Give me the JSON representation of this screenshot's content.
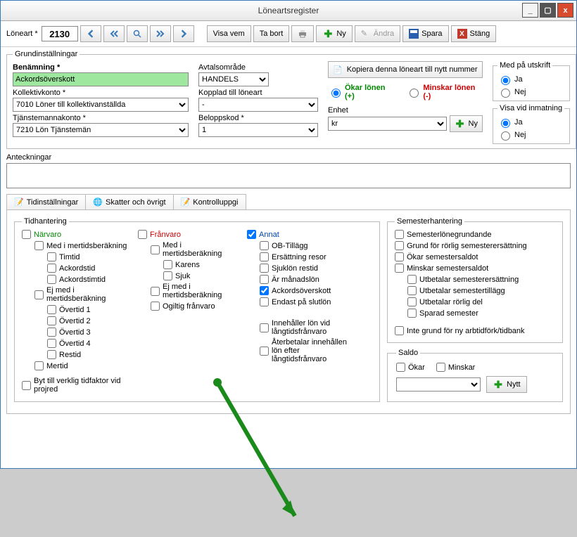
{
  "window": {
    "title": "Löneartsregister"
  },
  "toolbar": {
    "loneart_label": "Löneart *",
    "loneart_value": "2130",
    "visa_vem": "Visa vem",
    "ta_bort": "Ta bort",
    "ny": "Ny",
    "andra": "Ändra",
    "spara": "Spara",
    "stang": "Stäng"
  },
  "grund": {
    "legend": "Grundinställningar",
    "benamning_label": "Benämning *",
    "benamning_value": "Ackordsöverskott",
    "avtalsomrade_label": "Avtalsområde",
    "avtalsomrade_value": "HANDELS",
    "kopiera": "Kopiera denna löneart till nytt nummer",
    "okar": "Ökar lönen (+)",
    "minskar": "Minskar lönen (-)",
    "kollektiv_label": "Kollektivkonto *",
    "kollektiv_value": "7010 Löner till kollektivanställda",
    "kopplad_label": "Kopplad till löneart",
    "kopplad_value": "-",
    "enhet_label": "Enhet",
    "enhet_value": "kr",
    "enhet_ny": "Ny",
    "tjanste_label": "Tjänstemannakonto *",
    "tjanste_value": "7210 Lön Tjänstemän",
    "belopp_label": "Beloppskod *",
    "belopp_value": "1"
  },
  "medpa": {
    "legend": "Med på utskrift",
    "ja": "Ja",
    "nej": "Nej"
  },
  "visavid": {
    "legend": "Visa vid inmatning",
    "ja": "Ja",
    "nej": "Nej"
  },
  "anteck_label": "Anteckningar",
  "tabs": {
    "tid": "Tidinställningar",
    "skatt": "Skatter och övrigt",
    "kontroll": "Kontrolluppgi"
  },
  "tidh": {
    "legend": "Tidhantering",
    "narvaro": "Närvaro",
    "med_mertid": "Med i mertidsberäkning",
    "timtid": "Timtid",
    "ackordstid": "Ackordstid",
    "ackordstimtid": "Ackordstimtid",
    "ej_mertid": "Ej med i mertidsberäkning",
    "ot1": "Övertid 1",
    "ot2": "Övertid 2",
    "ot3": "Övertid 3",
    "ot4": "Övertid 4",
    "restid": "Restid",
    "mertid": "Mertid",
    "byt": "Byt till verklig tidfaktor vid projred",
    "franvaro": "Frånvaro",
    "med_mertid2": "Med i mertidsberäkning",
    "karens": "Karens",
    "sjuk": "Sjuk",
    "ej_mertid2": "Ej med i mertidsberäkning",
    "ogiltig": "Ogiltig frånvaro",
    "annat": "Annat",
    "ob": "OB-Tillägg",
    "ersatt": "Ersättning resor",
    "sjuklon": "Sjuklön restid",
    "manad": "Är månadslön",
    "ackover": "Ackordsöverskott",
    "endast": "Endast på slutlön",
    "innehall": "Innehåller lön vid långtidsfrånvaro",
    "aterbet": "Återbetalar innehållen lön efter långtidsfrånvaro"
  },
  "sem": {
    "legend": "Semesterhantering",
    "grundande": "Semesterlönegrundande",
    "grund_rorlig": "Grund för rörlig semesterersättning",
    "okar_saldo": "Ökar semestersaldot",
    "minskar_saldo": "Minskar semestersaldot",
    "ut_ersatt": "Utbetalar semesterersättning",
    "ut_tillag": "Utbetalar semestertillägg",
    "ut_rorlig": "Utbetalar rörlig del",
    "sparad": "Sparad semester",
    "inte_grund": "Inte grund för ny arbtidförk/tidbank"
  },
  "saldo": {
    "legend": "Saldo",
    "okar": "Ökar",
    "minskar": "Minskar",
    "nytt": "Nytt"
  }
}
